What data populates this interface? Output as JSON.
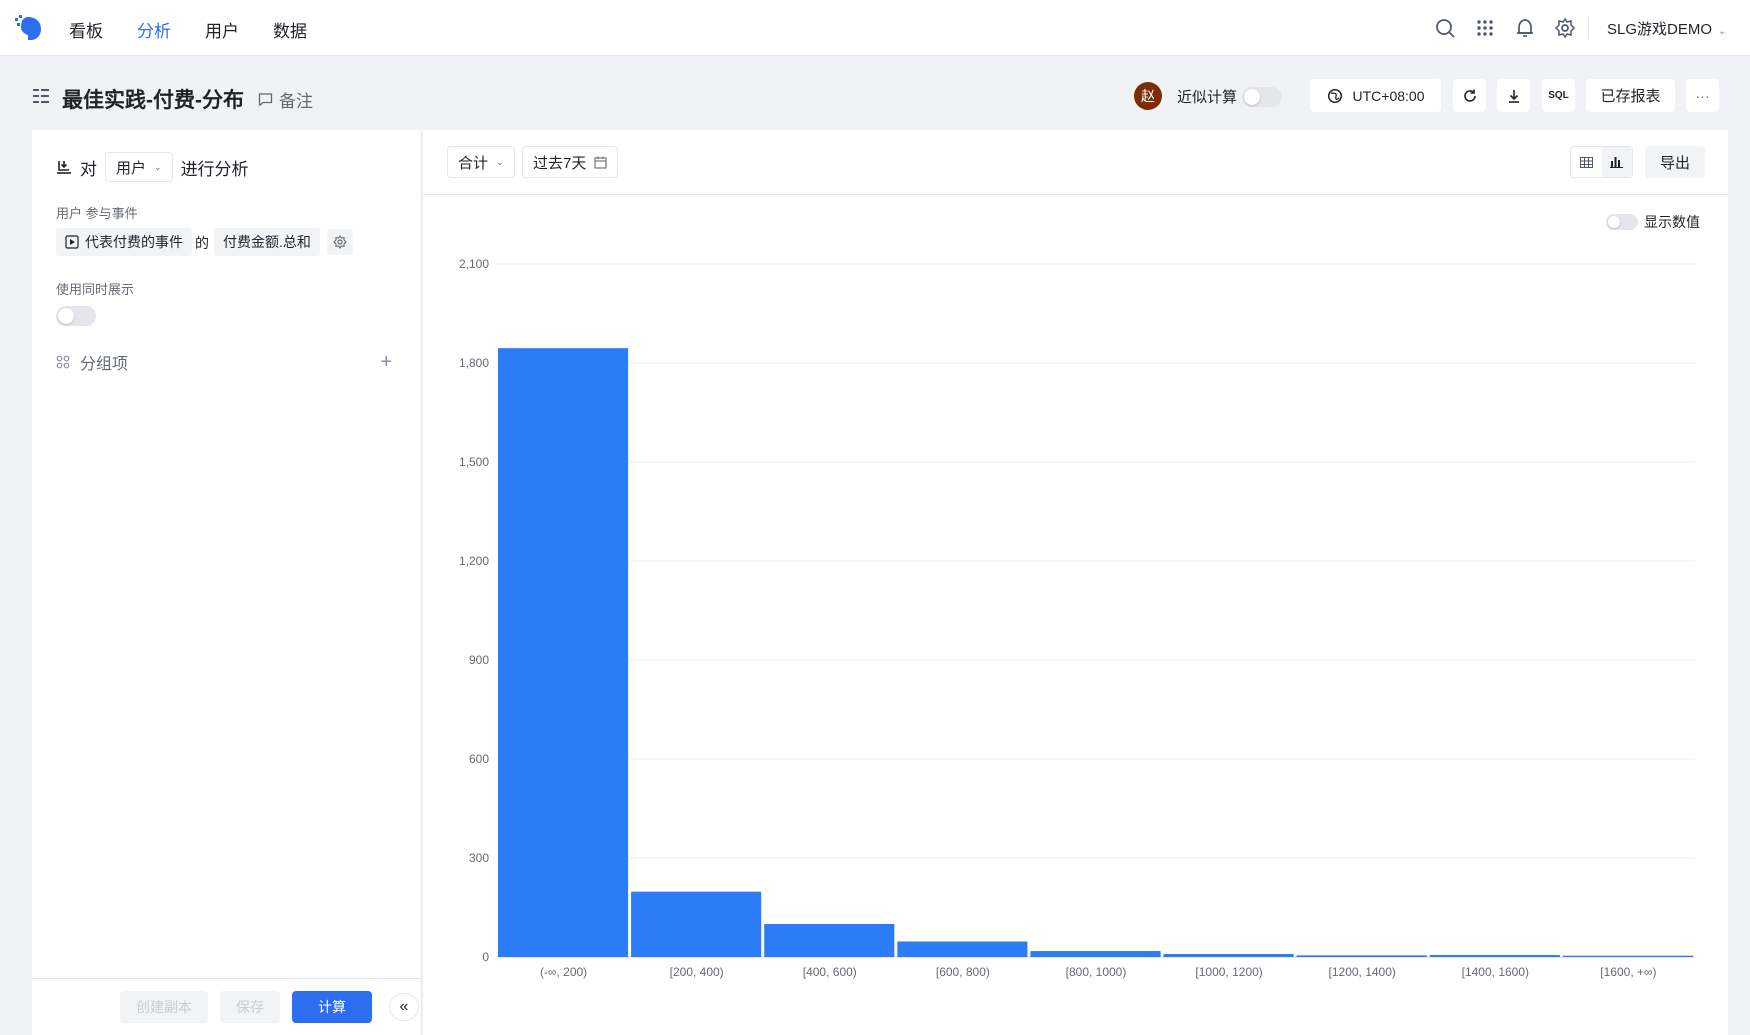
{
  "nav": {
    "items": [
      "看板",
      "分析",
      "用户",
      "数据"
    ],
    "active_index": 1,
    "project": "SLG游戏DEMO"
  },
  "titlebar": {
    "title": "最佳实践-付费-分布",
    "note_label": "备注",
    "avatar_text": "赵",
    "approx_label": "近似计算",
    "timezone": "UTC+08:00",
    "sql_label": "SQL",
    "saved_reports_label": "已存报表",
    "more_label": "···"
  },
  "left_panel": {
    "prefix": "对",
    "entity": "用户",
    "suffix": "进行分析",
    "event_section_label": "用户 参与事件",
    "event_name": "代表付费的事件",
    "of_text": "的",
    "metric": "付费金额.总和",
    "simultaneous_label": "使用同时展示",
    "group_label": "分组项",
    "footer": {
      "copy_label": "创建副本",
      "save_label": "保存",
      "compute_label": "计算",
      "collapse_label": "«"
    }
  },
  "right_panel": {
    "aggregate": "合计",
    "date_range": "过去7天",
    "export_label": "导出",
    "show_values_label": "显示数值"
  },
  "colors": {
    "accent": "#2b6ff0",
    "bar": "#2b7cf6",
    "avatar_bg": "#7a2e08"
  },
  "chart_data": {
    "type": "bar",
    "categories": [
      "(-∞, 200)",
      "[200, 400)",
      "[400, 600)",
      "[600, 800)",
      "[800, 1000)",
      "[1000, 1200)",
      "[1200, 1400)",
      "[1400, 1600)",
      "[1600, +∞)"
    ],
    "values": [
      1845,
      198,
      100,
      47,
      18,
      9,
      5,
      6,
      4
    ],
    "ylim": [
      0,
      2100
    ],
    "yticks": [
      "0",
      "300",
      "600",
      "900",
      "1,200",
      "1,500",
      "1,800",
      "2,100"
    ],
    "grid": true
  }
}
